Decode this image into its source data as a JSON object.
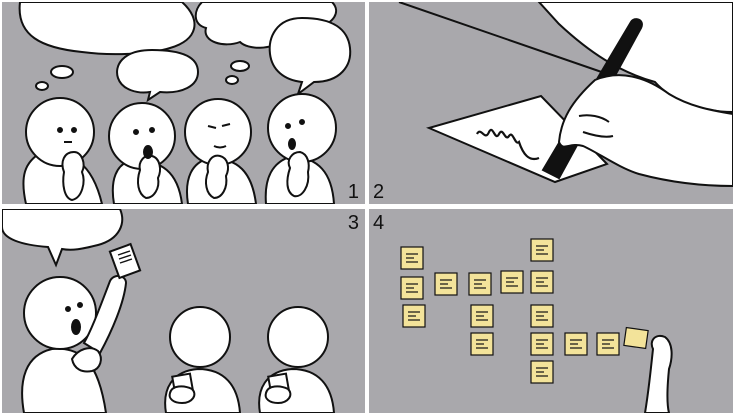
{
  "panels": [
    {
      "number": "1",
      "scene": "group-thinking"
    },
    {
      "number": "2",
      "scene": "hand-writing-note"
    },
    {
      "number": "3",
      "scene": "presenter-with-note"
    },
    {
      "number": "4",
      "scene": "sticky-note-wall"
    }
  ],
  "colors": {
    "panel_background": "#a9a8ac",
    "line": "#111111",
    "figure_fill": "#ffffff",
    "sticky_note": "#f3e39a"
  }
}
